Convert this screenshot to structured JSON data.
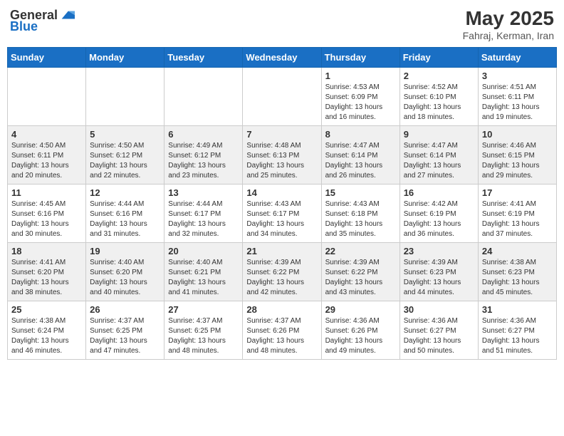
{
  "header": {
    "logo_general": "General",
    "logo_blue": "Blue",
    "month_title": "May 2025",
    "location": "Fahraj, Kerman, Iran"
  },
  "days_of_week": [
    "Sunday",
    "Monday",
    "Tuesday",
    "Wednesday",
    "Thursday",
    "Friday",
    "Saturday"
  ],
  "weeks": [
    [
      {
        "day": "",
        "info": ""
      },
      {
        "day": "",
        "info": ""
      },
      {
        "day": "",
        "info": ""
      },
      {
        "day": "",
        "info": ""
      },
      {
        "day": "1",
        "info": "Sunrise: 4:53 AM\nSunset: 6:09 PM\nDaylight: 13 hours and 16 minutes."
      },
      {
        "day": "2",
        "info": "Sunrise: 4:52 AM\nSunset: 6:10 PM\nDaylight: 13 hours and 18 minutes."
      },
      {
        "day": "3",
        "info": "Sunrise: 4:51 AM\nSunset: 6:11 PM\nDaylight: 13 hours and 19 minutes."
      }
    ],
    [
      {
        "day": "4",
        "info": "Sunrise: 4:50 AM\nSunset: 6:11 PM\nDaylight: 13 hours and 20 minutes."
      },
      {
        "day": "5",
        "info": "Sunrise: 4:50 AM\nSunset: 6:12 PM\nDaylight: 13 hours and 22 minutes."
      },
      {
        "day": "6",
        "info": "Sunrise: 4:49 AM\nSunset: 6:12 PM\nDaylight: 13 hours and 23 minutes."
      },
      {
        "day": "7",
        "info": "Sunrise: 4:48 AM\nSunset: 6:13 PM\nDaylight: 13 hours and 25 minutes."
      },
      {
        "day": "8",
        "info": "Sunrise: 4:47 AM\nSunset: 6:14 PM\nDaylight: 13 hours and 26 minutes."
      },
      {
        "day": "9",
        "info": "Sunrise: 4:47 AM\nSunset: 6:14 PM\nDaylight: 13 hours and 27 minutes."
      },
      {
        "day": "10",
        "info": "Sunrise: 4:46 AM\nSunset: 6:15 PM\nDaylight: 13 hours and 29 minutes."
      }
    ],
    [
      {
        "day": "11",
        "info": "Sunrise: 4:45 AM\nSunset: 6:16 PM\nDaylight: 13 hours and 30 minutes."
      },
      {
        "day": "12",
        "info": "Sunrise: 4:44 AM\nSunset: 6:16 PM\nDaylight: 13 hours and 31 minutes."
      },
      {
        "day": "13",
        "info": "Sunrise: 4:44 AM\nSunset: 6:17 PM\nDaylight: 13 hours and 32 minutes."
      },
      {
        "day": "14",
        "info": "Sunrise: 4:43 AM\nSunset: 6:17 PM\nDaylight: 13 hours and 34 minutes."
      },
      {
        "day": "15",
        "info": "Sunrise: 4:43 AM\nSunset: 6:18 PM\nDaylight: 13 hours and 35 minutes."
      },
      {
        "day": "16",
        "info": "Sunrise: 4:42 AM\nSunset: 6:19 PM\nDaylight: 13 hours and 36 minutes."
      },
      {
        "day": "17",
        "info": "Sunrise: 4:41 AM\nSunset: 6:19 PM\nDaylight: 13 hours and 37 minutes."
      }
    ],
    [
      {
        "day": "18",
        "info": "Sunrise: 4:41 AM\nSunset: 6:20 PM\nDaylight: 13 hours and 38 minutes."
      },
      {
        "day": "19",
        "info": "Sunrise: 4:40 AM\nSunset: 6:20 PM\nDaylight: 13 hours and 40 minutes."
      },
      {
        "day": "20",
        "info": "Sunrise: 4:40 AM\nSunset: 6:21 PM\nDaylight: 13 hours and 41 minutes."
      },
      {
        "day": "21",
        "info": "Sunrise: 4:39 AM\nSunset: 6:22 PM\nDaylight: 13 hours and 42 minutes."
      },
      {
        "day": "22",
        "info": "Sunrise: 4:39 AM\nSunset: 6:22 PM\nDaylight: 13 hours and 43 minutes."
      },
      {
        "day": "23",
        "info": "Sunrise: 4:39 AM\nSunset: 6:23 PM\nDaylight: 13 hours and 44 minutes."
      },
      {
        "day": "24",
        "info": "Sunrise: 4:38 AM\nSunset: 6:23 PM\nDaylight: 13 hours and 45 minutes."
      }
    ],
    [
      {
        "day": "25",
        "info": "Sunrise: 4:38 AM\nSunset: 6:24 PM\nDaylight: 13 hours and 46 minutes."
      },
      {
        "day": "26",
        "info": "Sunrise: 4:37 AM\nSunset: 6:25 PM\nDaylight: 13 hours and 47 minutes."
      },
      {
        "day": "27",
        "info": "Sunrise: 4:37 AM\nSunset: 6:25 PM\nDaylight: 13 hours and 48 minutes."
      },
      {
        "day": "28",
        "info": "Sunrise: 4:37 AM\nSunset: 6:26 PM\nDaylight: 13 hours and 48 minutes."
      },
      {
        "day": "29",
        "info": "Sunrise: 4:36 AM\nSunset: 6:26 PM\nDaylight: 13 hours and 49 minutes."
      },
      {
        "day": "30",
        "info": "Sunrise: 4:36 AM\nSunset: 6:27 PM\nDaylight: 13 hours and 50 minutes."
      },
      {
        "day": "31",
        "info": "Sunrise: 4:36 AM\nSunset: 6:27 PM\nDaylight: 13 hours and 51 minutes."
      }
    ]
  ]
}
